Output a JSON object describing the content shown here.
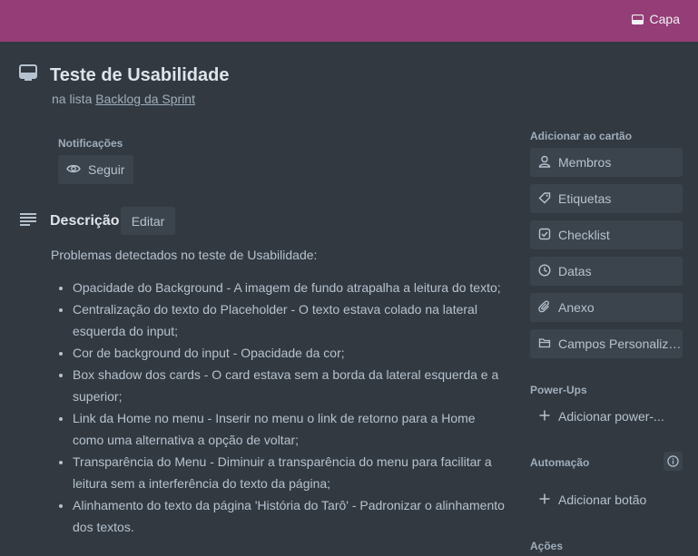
{
  "cover": {
    "label": "Capa"
  },
  "card": {
    "title": "Teste de Usabilidade",
    "list_prefix": "na lista",
    "list_name": "Backlog da Sprint"
  },
  "notifications": {
    "label": "Notificações",
    "follow_label": "Seguir"
  },
  "description": {
    "title": "Descrição",
    "edit_label": "Editar",
    "intro": "Problemas detectados no teste de Usabilidade:",
    "items": [
      "Opacidade do Background - A imagem de fundo atrapalha a leitura do texto;",
      "Centralização do texto do Placeholder - O texto estava colado na lateral esquerda do input;",
      "Cor de background do input - Opacidade da cor;",
      "Box shadow dos cards - O card estava sem a borda da lateral esquerda e a superior;",
      "Link da Home no menu - Inserir no menu o link de retorno para a Home como uma alternativa a opção de voltar;",
      "Transparência do Menu - Diminuir a transparência do menu para facilitar a leitura sem a interferência do texto da página;",
      "Alinhamento do texto da página 'História do Tarô' - Padronizar o alinhamento dos textos."
    ]
  },
  "sidebar": {
    "add_to_card_label": "Adicionar ao cartão",
    "add_buttons": [
      {
        "label": "Membros",
        "icon": "person-icon"
      },
      {
        "label": "Etiquetas",
        "icon": "tag-icon"
      },
      {
        "label": "Checklist",
        "icon": "checkbox-icon"
      },
      {
        "label": "Datas",
        "icon": "clock-icon"
      },
      {
        "label": "Anexo",
        "icon": "paperclip-icon"
      },
      {
        "label": "Campos Personaliza...",
        "icon": "folder-icon"
      }
    ],
    "powerups_label": "Power-Ups",
    "add_powerup_label": "Adicionar power-...",
    "automation_label": "Automação",
    "add_button_label": "Adicionar botão",
    "actions_label": "Ações"
  },
  "colors": {
    "cover": "#953d77",
    "background": "#323940",
    "button": "#3b444c"
  }
}
